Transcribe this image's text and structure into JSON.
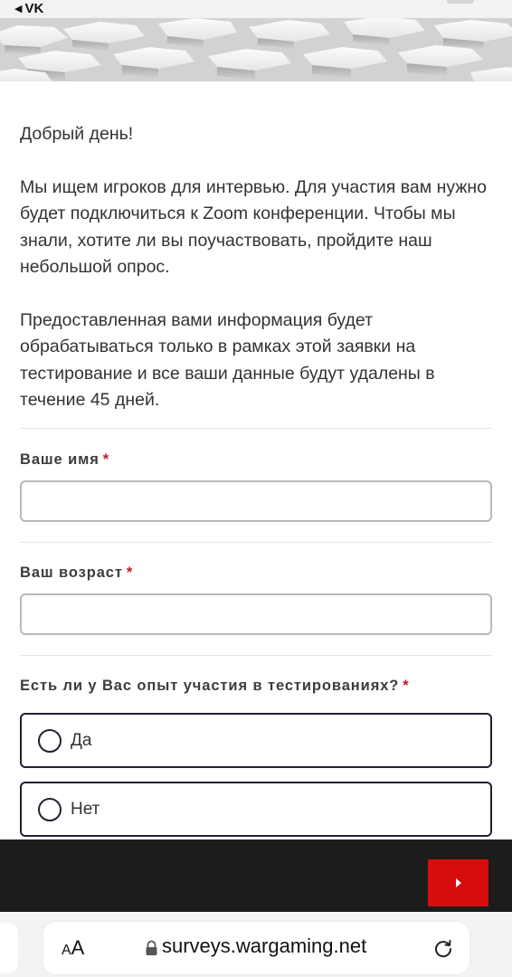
{
  "status_bar": {
    "back_label": "VK"
  },
  "intro": {
    "greeting": "Добрый день!",
    "paragraph_1": "Мы ищем игроков для интервью. Для участия вам нужно будет подключиться к Zoom конференции. Чтобы мы знали, хотите ли вы поучаствовать, пройдите наш небольшой опрос.",
    "paragraph_2": "Предоставленная вами информация будет обрабатываться только в рамках этой заявки на тестирование и все ваши данные будут удалены в течение 45 дней."
  },
  "form": {
    "name_field": {
      "label": "Ваше имя",
      "required_mark": "*",
      "value": ""
    },
    "age_field": {
      "label": "Ваш возраст",
      "required_mark": "*",
      "value": ""
    },
    "experience_question": {
      "label": "Есть ли у Вас опыт участия в тестированиях?",
      "required_mark": "*",
      "options": [
        "Да",
        "Нет"
      ]
    }
  },
  "footer": {
    "next_icon": "play-arrow-icon"
  },
  "browser": {
    "text_size_label_small": "A",
    "text_size_label_large": "A",
    "url": "surveys.wargaming.net",
    "lock_icon": "lock-icon",
    "reload_icon": "reload-icon"
  },
  "colors": {
    "accent_red": "#d60d0d",
    "required_red": "#c01c28",
    "footer_bg": "#1c1c1c",
    "radio_border": "#1e2232"
  }
}
